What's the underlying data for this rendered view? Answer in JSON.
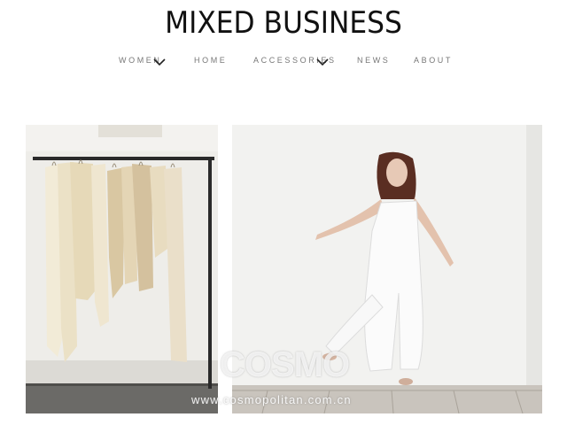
{
  "header": {
    "logo_text": "MIXED BUSINESS"
  },
  "nav": {
    "items": [
      {
        "label": "WOMEN",
        "has_dropdown": true
      },
      {
        "label": "HOME",
        "has_dropdown": false
      },
      {
        "label": "ACCESSORIES",
        "has_dropdown": true
      },
      {
        "label": "NEWS",
        "has_dropdown": false
      },
      {
        "label": "ABOUT",
        "has_dropdown": false
      }
    ]
  },
  "watermark": {
    "brand": "COSMO",
    "url": "www.cosmopolitan.com.cn"
  },
  "colors": {
    "text": "#111111",
    "nav_text": "#777777",
    "background": "#ffffff"
  }
}
